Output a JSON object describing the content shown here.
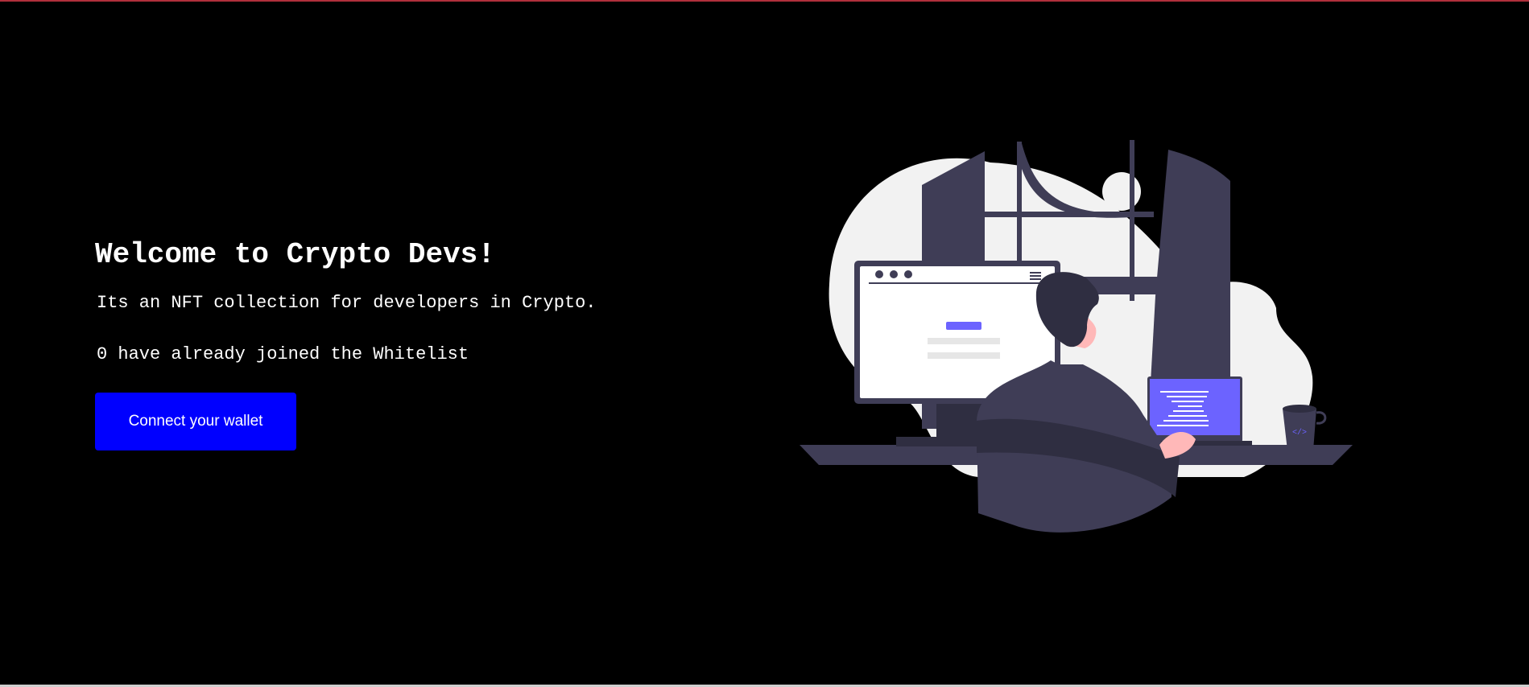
{
  "hero": {
    "title": "Welcome to Crypto Devs!",
    "description": "Its an NFT collection for developers in Crypto.",
    "whitelist_status": "0 have already joined the Whitelist",
    "connect_button_label": "Connect your wallet"
  },
  "illustration": {
    "name": "developer-at-desk-illustration",
    "laptop_icon": "code-brackets-icon",
    "mug_icon": "code-brackets-icon"
  },
  "colors": {
    "background": "#000000",
    "button": "#0000ff",
    "text": "#ffffff",
    "accent": "#6c63ff",
    "dark_shape": "#3f3d56"
  }
}
